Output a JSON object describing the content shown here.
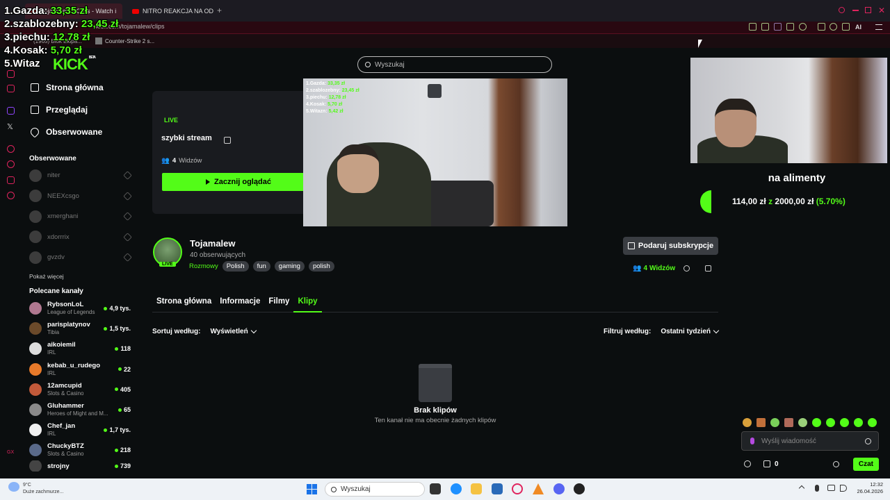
{
  "browser": {
    "tabs": [
      {
        "label": "Tojamalew - Clips - Watch i"
      },
      {
        "label": "NITRO REAKCJA NA ODP"
      }
    ],
    "url": "kick.com/tojamalew/clips",
    "bookmarks": [
      "(1965) Blok Ekipa...",
      "Counter-Strike 2 s..."
    ],
    "ai_label": "AI"
  },
  "overlay": {
    "leaderboard": [
      {
        "rank": "1.",
        "name": "Gazda:",
        "amount": "33,35 zł"
      },
      {
        "rank": "2.",
        "name": "szablozebny:",
        "amount": "23,45 zł"
      },
      {
        "rank": "3.",
        "name": "piechu:",
        "amount": "12,78 zł"
      },
      {
        "rank": "4.",
        "name": "Kosak:",
        "amount": "5,70 zł"
      },
      {
        "rank": "5.",
        "name": "Witaz",
        "amount": ""
      }
    ],
    "mini": [
      {
        "name": "1.Gazda: ",
        "amount": "33,35 zł"
      },
      {
        "name": "2.szablozebny: ",
        "amount": "23,45 zł"
      },
      {
        "name": "3.piechu: ",
        "amount": "12,78 zł"
      },
      {
        "name": "4.Kosak: ",
        "amount": "5,70 zł"
      },
      {
        "name": "5.Witazn: ",
        "amount": "5,42 zł"
      }
    ],
    "logo": "KICK",
    "logo_sup": "BETA"
  },
  "search": {
    "placeholder": "Wyszukaj"
  },
  "nav": [
    {
      "label": "Strona główna"
    },
    {
      "label": "Przeglądaj"
    },
    {
      "label": "Obserwowane"
    }
  ],
  "followed": {
    "heading": "Obserwowane",
    "channels": [
      "niter",
      "NEEXcsgo",
      "xmerghani",
      "xdorrrix",
      "gvzdv"
    ],
    "show_more": "Pokaż więcej"
  },
  "recommended": {
    "heading": "Polecane kanały",
    "channels": [
      {
        "name": "RybsonLoL",
        "category": "League of Legends",
        "viewers": "4,9 tys."
      },
      {
        "name": "parisplatynov",
        "category": "Tibia",
        "viewers": "1,5 tys."
      },
      {
        "name": "aikoiemil",
        "category": "IRL",
        "viewers": "118"
      },
      {
        "name": "kebab_u_rudego",
        "category": "IRL",
        "viewers": "22"
      },
      {
        "name": "12amcupid",
        "category": "Slots & Casino",
        "viewers": "405"
      },
      {
        "name": "Gluhammer",
        "category": "Heroes of Might and M...",
        "viewers": "65"
      },
      {
        "name": "Chef_jan",
        "category": "IRL",
        "viewers": "1,7 tys."
      },
      {
        "name": "ChuckyBTZ",
        "category": "Slots & Casino",
        "viewers": "218"
      },
      {
        "name": "strojny",
        "category": "",
        "viewers": "739"
      }
    ]
  },
  "hero": {
    "live": "LIVE",
    "title": "szybki stream",
    "viewers_count": "4",
    "viewers_label": "Widzów",
    "watch_button": "Zacznij oglądać"
  },
  "goal": {
    "title": "na alimenty",
    "current": "114,00 zł",
    "separator": "z",
    "target": "2000,00 zł",
    "percent": "(5.70%)"
  },
  "channel": {
    "name": "Tojamalew",
    "followers": "40 obserwujących",
    "live": "LIVE",
    "category": "Rozmowy",
    "tags": [
      "Polish",
      "fun",
      "gaming",
      "polish"
    ],
    "subscribe_button": "Podaruj subskrypcje",
    "viewers_count": "4",
    "viewers_label": "Widzów"
  },
  "tabs": [
    {
      "label": "Strona główna"
    },
    {
      "label": "Informacje"
    },
    {
      "label": "Filmy"
    },
    {
      "label": "Klipy"
    }
  ],
  "clips": {
    "sort_label": "Sortuj według:",
    "sort_value": "Wyświetleń",
    "filter_label": "Filtruj według:",
    "filter_value": "Ostatni tydzień",
    "empty_title": "Brak klipów",
    "empty_sub": "Ten kanał nie ma obecnie żadnych klipów"
  },
  "chat": {
    "placeholder": "Wyślij wiadomość",
    "points": "0",
    "chat_button": "Czat"
  },
  "taskbar": {
    "temperature": "9°C",
    "weather": "Duże zachmurze...",
    "search_placeholder": "Wyszukaj",
    "time": "12:32",
    "date": "26.04.2026"
  },
  "colors": {
    "accent": "#53fc18",
    "background": "#0b0e0f",
    "card": "#191b1f"
  }
}
